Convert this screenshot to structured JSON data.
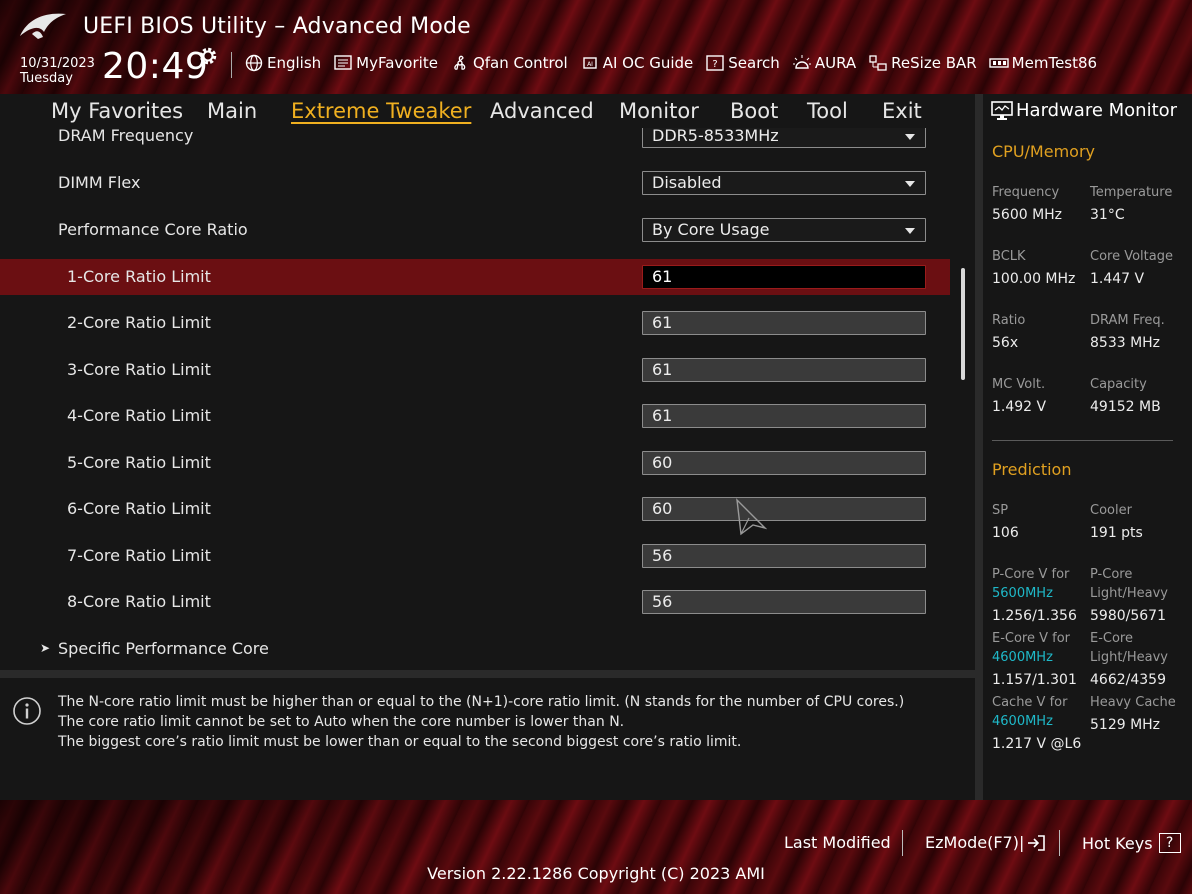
{
  "header": {
    "title": "UEFI BIOS Utility – Advanced Mode",
    "date": "10/31/2023",
    "day": "Tuesday",
    "time": "20:49",
    "tools": [
      {
        "label": "English",
        "icon": "globe-icon"
      },
      {
        "label": "MyFavorite",
        "icon": "favorite-list-icon"
      },
      {
        "label": "Qfan Control",
        "icon": "fan-icon"
      },
      {
        "label": "AI OC Guide",
        "icon": "ai-chip-icon"
      },
      {
        "label": "Search",
        "icon": "search-help-icon"
      },
      {
        "label": "AURA",
        "icon": "aura-light-icon"
      },
      {
        "label": "ReSize BAR",
        "icon": "resize-bar-icon"
      },
      {
        "label": "MemTest86",
        "icon": "memtest-icon"
      }
    ]
  },
  "tabs": [
    "My Favorites",
    "Main",
    "Extreme Tweaker",
    "Advanced",
    "Monitor",
    "Boot",
    "Tool",
    "Exit"
  ],
  "active_tab": "Extreme Tweaker",
  "settings": [
    {
      "label": "DRAM Frequency",
      "type": "dropdown",
      "value": "DDR5-8533MHz"
    },
    {
      "label": "DIMM Flex",
      "type": "dropdown",
      "value": "Disabled"
    },
    {
      "label": "Performance Core Ratio",
      "type": "dropdown",
      "value": "By Core Usage"
    },
    {
      "label": "1-Core Ratio Limit",
      "type": "number",
      "value": "61",
      "selected": true
    },
    {
      "label": "2-Core Ratio Limit",
      "type": "number",
      "value": "61"
    },
    {
      "label": "3-Core Ratio Limit",
      "type": "number",
      "value": "61"
    },
    {
      "label": "4-Core Ratio Limit",
      "type": "number",
      "value": "61"
    },
    {
      "label": "5-Core Ratio Limit",
      "type": "number",
      "value": "60"
    },
    {
      "label": "6-Core Ratio Limit",
      "type": "number",
      "value": "60"
    },
    {
      "label": "7-Core Ratio Limit",
      "type": "number",
      "value": "56"
    },
    {
      "label": "8-Core Ratio Limit",
      "type": "number",
      "value": "56"
    },
    {
      "label": "Specific Performance Core",
      "type": "submenu"
    }
  ],
  "help": [
    "The N-core ratio limit must be higher than or equal to the (N+1)-core ratio limit. (N stands for the number of CPU cores.)",
    "The core ratio limit cannot be set to Auto when the core number is lower than N.",
    "The biggest core’s ratio limit must be lower than or equal to the second biggest core’s ratio limit."
  ],
  "hw": {
    "title": "Hardware Monitor",
    "cpu_mem": {
      "section": "CPU/Memory",
      "freq_label": "Frequency",
      "freq": "5600 MHz",
      "temp_label": "Temperature",
      "temp": "31°C",
      "bclk_label": "BCLK",
      "bclk": "100.00 MHz",
      "vcore_label": "Core Voltage",
      "vcore": "1.447 V",
      "ratio_label": "Ratio",
      "ratio": "56x",
      "dram_label": "DRAM Freq.",
      "dram": "8533 MHz",
      "mcv_label": "MC Volt.",
      "mcv": "1.492 V",
      "cap_label": "Capacity",
      "cap": "49152 MB"
    },
    "prediction": {
      "section": "Prediction",
      "sp_label": "SP",
      "sp": "106",
      "cooler_label": "Cooler",
      "cooler": "191 pts",
      "pcore_v_label": "P-Core V for",
      "pcore_v_freq": "5600MHz",
      "pcore_v": "1.256/1.356",
      "pcore_lh_label1": "P-Core",
      "pcore_lh_label2": "Light/Heavy",
      "pcore_lh": "5980/5671",
      "ecore_v_label": "E-Core V for",
      "ecore_v_freq": "4600MHz",
      "ecore_v": "1.157/1.301",
      "ecore_lh_label1": "E-Core",
      "ecore_lh_label2": "Light/Heavy",
      "ecore_lh": "4662/4359",
      "cache_v_label": "Cache V for",
      "cache_v_freq": "4600MHz",
      "cache_v": "1.217 V @L6",
      "heavy_cache_label": "Heavy Cache",
      "heavy_cache": "5129 MHz"
    }
  },
  "footer": {
    "last_modified": "Last Modified",
    "ezmode": "EzMode(F7)|",
    "hotkeys": "Hot Keys",
    "hotkeys_key": "?",
    "version": "Version 2.22.1286 Copyright (C) 2023 AMI"
  },
  "colors": {
    "accent": "#f0b020",
    "selection": "#6b0f12",
    "cyan": "#1fb9c9"
  }
}
